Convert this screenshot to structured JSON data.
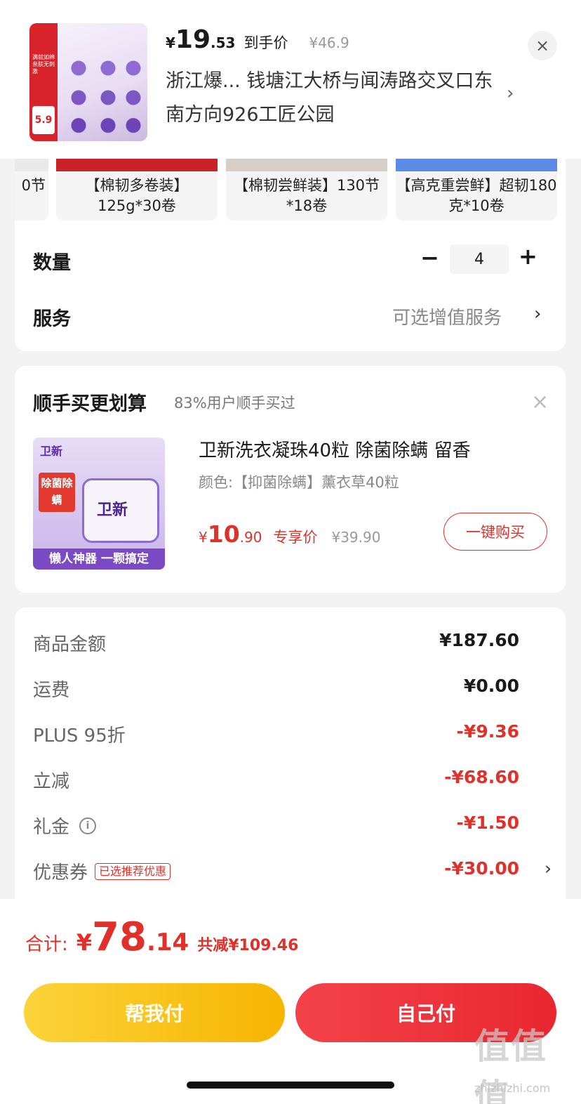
{
  "header": {
    "price_yen": "¥",
    "price_int": "19",
    "price_dec": ".53",
    "price_tag": "到手价",
    "orig_price": "¥46.9",
    "address": "浙江爆... 钱塘江大桥与闻涛路交叉口东南方向926工匠公园",
    "chevron": "›",
    "close": "×",
    "thumb_discount": "5.9",
    "thumb_top_text": "满就如棉 亲肤无刺激"
  },
  "variants": [
    {
      "label": "0节"
    },
    {
      "label": "【棉韧多卷装】125g*30卷"
    },
    {
      "label": "【棉韧尝鲜装】130节*18卷"
    },
    {
      "label": "【高克重尝鲜】超韧180克*10卷"
    }
  ],
  "quantity": {
    "label": "数量",
    "minus": "−",
    "value": "4",
    "plus": "+"
  },
  "service": {
    "label": "服务",
    "value": "可选增值服务",
    "chevron": "›"
  },
  "addon": {
    "title": "顺手买更划算",
    "subtitle": "83%用户顺手买过",
    "close": "×",
    "thumb_brand": "卫新",
    "thumb_tag": "除菌除螨",
    "thumb_tub": "卫新",
    "thumb_bottom": "懒人神器 一颗搞定",
    "name": "卫新洗衣凝珠40粒 除菌除螨 留香",
    "spec": "颜色:【抑菌除螨】薰衣草40粒",
    "price_yen": "¥",
    "price_int": "10",
    "price_dec": ".90",
    "price_tag": "专享价",
    "orig_price": "¥39.90",
    "buy_label": "一键购买"
  },
  "summary": {
    "rows": [
      {
        "label": "商品金额",
        "value": "¥187.60"
      },
      {
        "label": "运费",
        "value": "¥0.00"
      },
      {
        "label": "PLUS 95折",
        "value": "-¥9.36"
      },
      {
        "label": "立减",
        "value": "-¥68.60"
      },
      {
        "label": "礼金",
        "value": "-¥1.50"
      },
      {
        "label": "优惠券",
        "value": "-¥30.00",
        "tag": "已选推荐优惠"
      }
    ],
    "info_glyph": "i",
    "chevron": "›"
  },
  "footer": {
    "total_label": "合计:",
    "total_yen": "¥",
    "total_int": "78",
    "total_dec": ".14",
    "total_saving": "共减¥109.46",
    "help_pay": "帮我付",
    "self_pay": "自己付",
    "watermark": "值值值",
    "watermark_url": "zhizhizhi.com"
  },
  "colors": {
    "accent_red": "#e0302a",
    "help_yellow": "#f7b500",
    "pay_red": "#e8272f"
  }
}
